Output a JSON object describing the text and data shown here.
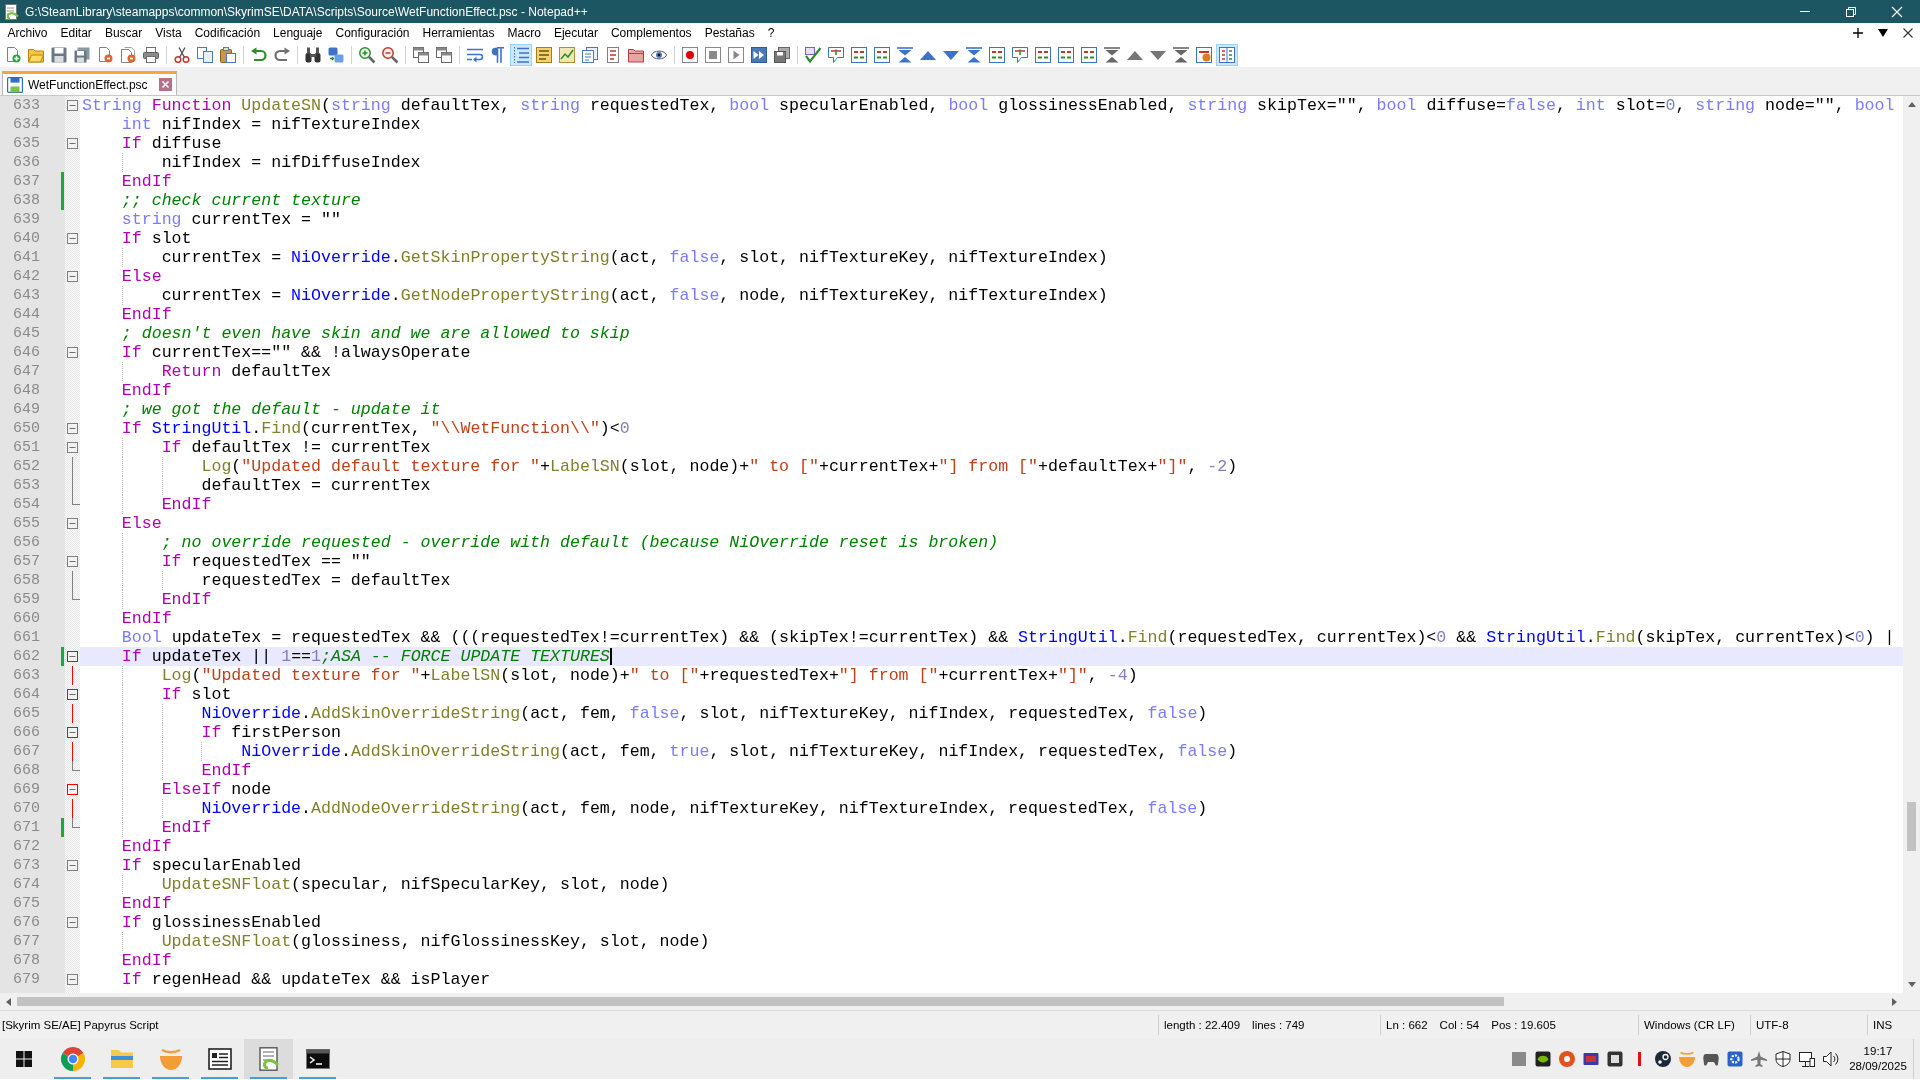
{
  "window": {
    "title": "G:\\SteamLibrary\\steamapps\\common\\SkyrimSE\\DATA\\Scripts\\Source\\WetFunctionEffect.psc - Notepad++"
  },
  "menu_bar": {
    "items": [
      "Archivo",
      "Editar",
      "Buscar",
      "Vista",
      "Codificación",
      "Lenguaje",
      "Configuración",
      "Herramientas",
      "Macro",
      "Ejecutar",
      "Complementos",
      "Pestañas",
      "?"
    ]
  },
  "toolbar": [
    {
      "buttons": [
        {
          "pressed": false
        },
        {
          "pressed": false
        },
        {
          "pressed": false
        },
        {
          "pressed": false
        },
        {
          "pressed": false
        },
        {
          "pressed": false
        },
        {
          "pressed": false
        }
      ]
    },
    {
      "buttons": [
        {
          "pressed": false
        },
        {
          "pressed": false
        },
        {
          "pressed": false
        }
      ]
    },
    {
      "buttons": [
        {
          "pressed": false
        },
        {
          "pressed": false
        }
      ]
    },
    {
      "buttons": [
        {
          "pressed": false
        },
        {
          "pressed": false
        }
      ]
    },
    {
      "buttons": [
        {
          "pressed": false
        },
        {
          "pressed": false
        }
      ]
    },
    {
      "buttons": [
        {
          "pressed": false
        },
        {
          "pressed": false
        }
      ]
    },
    {
      "buttons": [
        {
          "pressed": false
        },
        {
          "pressed": false
        },
        {
          "pressed": true
        },
        {
          "pressed": false
        },
        {
          "pressed": false
        },
        {
          "pressed": false
        },
        {
          "pressed": false
        },
        {
          "pressed": false
        },
        {
          "pressed": false
        }
      ]
    },
    {
      "buttons": [
        {
          "pressed": false
        },
        {
          "pressed": false
        },
        {
          "pressed": false
        },
        {
          "pressed": false
        },
        {
          "pressed": false
        }
      ]
    },
    {
      "buttons": [
        {
          "pressed": false
        },
        {
          "pressed": false
        },
        {
          "pressed": false
        },
        {
          "pressed": false
        },
        {
          "pressed": false
        },
        {
          "pressed": false
        },
        {
          "pressed": false
        },
        {
          "pressed": false
        },
        {
          "pressed": false
        },
        {
          "pressed": false
        },
        {
          "pressed": false
        },
        {
          "pressed": false
        },
        {
          "pressed": false
        },
        {
          "pressed": false
        },
        {
          "pressed": false
        },
        {
          "pressed": false
        },
        {
          "pressed": false
        },
        {
          "pressed": false
        },
        {
          "pressed": true
        }
      ]
    }
  ],
  "tabs": [
    {
      "label": "WetFunctionEffect.psc",
      "selected": true
    }
  ],
  "editor": {
    "lines": [
      {
        "number": "633",
        "current": false,
        "changed": false,
        "fold": {
          "kind": "start",
          "highlight": false
        },
        "tokens": [
          {
            "kind": "type",
            "text": "String"
          },
          {
            "kind": "keyword",
            "text": " Function"
          },
          {
            "kind": "function",
            "text": " UpdateSN"
          },
          {
            "kind": "plain",
            "text": "("
          },
          {
            "kind": "type",
            "text": "string"
          },
          {
            "kind": "plain",
            "text": " defaultTex, "
          },
          {
            "kind": "type",
            "text": "string"
          },
          {
            "kind": "plain",
            "text": " requestedTex, "
          },
          {
            "kind": "type",
            "text": "bool"
          },
          {
            "kind": "plain",
            "text": " specularEnabled, "
          },
          {
            "kind": "type",
            "text": "bool"
          },
          {
            "kind": "plain",
            "text": " glossinessEnabled, "
          },
          {
            "kind": "type",
            "text": "string"
          },
          {
            "kind": "plain",
            "text": " skipTex=\"\", "
          },
          {
            "kind": "type",
            "text": "bool"
          },
          {
            "kind": "plain",
            "text": " diffuse="
          },
          {
            "kind": "type",
            "text": "false"
          },
          {
            "kind": "plain",
            "text": ", "
          },
          {
            "kind": "type",
            "text": "int"
          },
          {
            "kind": "plain",
            "text": " slot="
          },
          {
            "kind": "number",
            "text": "0"
          },
          {
            "kind": "plain",
            "text": ", "
          },
          {
            "kind": "type",
            "text": "string"
          },
          {
            "kind": "plain",
            "text": " node=\"\", "
          },
          {
            "kind": "type",
            "text": "bool"
          }
        ],
        "children": [
          {
            "number": "634",
            "current": false,
            "changed": false,
            "tokens": [
              {
                "kind": "type",
                "text": "int"
              },
              {
                "kind": "plain",
                "text": " nifIndex = nifTextureIndex"
              }
            ]
          },
          {
            "number": "635",
            "current": false,
            "changed": false,
            "fold": {
              "kind": "start",
              "highlight": false
            },
            "tokens": [
              {
                "kind": "keyword",
                "text": "If"
              },
              {
                "kind": "plain",
                "text": " diffuse"
              }
            ],
            "children": [
              {
                "number": "636",
                "current": false,
                "changed": false,
                "tokens": [
                  {
                    "kind": "plain",
                    "text": "nifIndex = nifDiffuseIndex"
                  }
                ]
              }
            ]
          },
          {
            "number": "637",
            "current": false,
            "changed": true,
            "tokens": [
              {
                "kind": "keyword",
                "text": "EndIf"
              }
            ]
          },
          {
            "number": "638",
            "current": false,
            "changed": true,
            "tokens": [
              {
                "kind": "comment",
                "text": ";; check current texture"
              }
            ]
          },
          {
            "number": "639",
            "current": false,
            "changed": false,
            "tokens": [
              {
                "kind": "type",
                "text": "string"
              },
              {
                "kind": "plain",
                "text": " currentTex = \"\""
              }
            ]
          },
          {
            "number": "640",
            "current": false,
            "changed": false,
            "fold": {
              "kind": "start",
              "highlight": false
            },
            "tokens": [
              {
                "kind": "keyword",
                "text": "If"
              },
              {
                "kind": "plain",
                "text": " slot"
              }
            ],
            "children": [
              {
                "number": "641",
                "current": false,
                "changed": false,
                "tokens": [
                  {
                    "kind": "plain",
                    "text": "currentTex = "
                  },
                  {
                    "kind": "class",
                    "text": "NiOverride"
                  },
                  {
                    "kind": "plain",
                    "text": "."
                  },
                  {
                    "kind": "function",
                    "text": "GetSkinPropertyString"
                  },
                  {
                    "kind": "plain",
                    "text": "(act, "
                  },
                  {
                    "kind": "type",
                    "text": "false"
                  },
                  {
                    "kind": "plain",
                    "text": ", slot, nifTextureKey, nifTextureIndex)"
                  }
                ]
              }
            ]
          },
          {
            "number": "642",
            "current": false,
            "changed": false,
            "fold": {
              "kind": "start",
              "highlight": false
            },
            "tokens": [
              {
                "kind": "keyword",
                "text": "Else"
              }
            ],
            "children": [
              {
                "number": "643",
                "current": false,
                "changed": false,
                "tokens": [
                  {
                    "kind": "plain",
                    "text": "currentTex = "
                  },
                  {
                    "kind": "class",
                    "text": "NiOverride"
                  },
                  {
                    "kind": "plain",
                    "text": "."
                  },
                  {
                    "kind": "function",
                    "text": "GetNodePropertyString"
                  },
                  {
                    "kind": "plain",
                    "text": "(act, "
                  },
                  {
                    "kind": "type",
                    "text": "false"
                  },
                  {
                    "kind": "plain",
                    "text": ", node, nifTextureKey, nifTextureIndex)"
                  }
                ]
              }
            ]
          },
          {
            "number": "644",
            "current": false,
            "changed": false,
            "tokens": [
              {
                "kind": "keyword",
                "text": "EndIf"
              }
            ]
          },
          {
            "number": "645",
            "current": false,
            "changed": false,
            "tokens": [
              {
                "kind": "comment",
                "text": "; doesn't even have skin and we are allowed to skip"
              }
            ]
          },
          {
            "number": "646",
            "current": false,
            "changed": false,
            "fold": {
              "kind": "start",
              "highlight": false
            },
            "tokens": [
              {
                "kind": "keyword",
                "text": "If"
              },
              {
                "kind": "plain",
                "text": " currentTex==\"\" && !alwaysOperate"
              }
            ],
            "children": [
              {
                "number": "647",
                "current": false,
                "changed": false,
                "tokens": [
                  {
                    "kind": "keyword",
                    "text": "Return"
                  },
                  {
                    "kind": "plain",
                    "text": " defaultTex"
                  }
                ]
              }
            ]
          },
          {
            "number": "648",
            "current": false,
            "changed": false,
            "tokens": [
              {
                "kind": "keyword",
                "text": "EndIf"
              }
            ]
          },
          {
            "number": "649",
            "current": false,
            "changed": false,
            "tokens": [
              {
                "kind": "comment",
                "text": "; we got the default - update it"
              }
            ]
          },
          {
            "number": "650",
            "current": false,
            "changed": false,
            "fold": {
              "kind": "start",
              "highlight": false
            },
            "tokens": [
              {
                "kind": "keyword",
                "text": "If"
              },
              {
                "kind": "class",
                "text": " StringUtil"
              },
              {
                "kind": "plain",
                "text": "."
              },
              {
                "kind": "function",
                "text": "Find"
              },
              {
                "kind": "plain",
                "text": "(currentTex, "
              },
              {
                "kind": "string",
                "text": "\"\\\\WetFunction\\\\\""
              },
              {
                "kind": "plain",
                "text": ")<"
              },
              {
                "kind": "number",
                "text": "0"
              }
            ],
            "children": [
              {
                "number": "651",
                "current": false,
                "changed": false,
                "fold": {
                  "kind": "start",
                  "highlight": false
                },
                "tokens": [
                  {
                    "kind": "keyword",
                    "text": "If"
                  },
                  {
                    "kind": "plain",
                    "text": " defaultTex != currentTex"
                  }
                ],
                "children": [
                  {
                    "number": "652",
                    "current": false,
                    "changed": false,
                    "fold": {
                      "kind": "line",
                      "highlight": false
                    },
                    "tokens": [
                      {
                        "kind": "function",
                        "text": "Log"
                      },
                      {
                        "kind": "plain",
                        "text": "("
                      },
                      {
                        "kind": "string",
                        "text": "\"Updated default texture for \""
                      },
                      {
                        "kind": "plain",
                        "text": "+"
                      },
                      {
                        "kind": "function",
                        "text": "LabelSN"
                      },
                      {
                        "kind": "plain",
                        "text": "(slot, node)+"
                      },
                      {
                        "kind": "string",
                        "text": "\" to [\""
                      },
                      {
                        "kind": "plain",
                        "text": "+currentTex+"
                      },
                      {
                        "kind": "string",
                        "text": "\"] from [\""
                      },
                      {
                        "kind": "plain",
                        "text": "+defaultTex+"
                      },
                      {
                        "kind": "string",
                        "text": "\"]\""
                      },
                      {
                        "kind": "plain",
                        "text": ", "
                      },
                      {
                        "kind": "number",
                        "text": "-2"
                      },
                      {
                        "kind": "plain",
                        "text": ")"
                      }
                    ]
                  },
                  {
                    "number": "653",
                    "current": false,
                    "changed": false,
                    "fold": {
                      "kind": "line",
                      "highlight": false
                    },
                    "tokens": [
                      {
                        "kind": "plain",
                        "text": "defaultTex = currentTex"
                      }
                    ]
                  }
                ]
              },
              {
                "number": "654",
                "current": false,
                "changed": false,
                "fold": {
                  "kind": "end",
                  "highlight": false
                },
                "tokens": [
                  {
                    "kind": "keyword",
                    "text": "EndIf"
                  }
                ]
              }
            ]
          },
          {
            "number": "655",
            "current": false,
            "changed": false,
            "fold": {
              "kind": "start",
              "highlight": false
            },
            "tokens": [
              {
                "kind": "keyword",
                "text": "Else"
              }
            ],
            "children": [
              {
                "number": "656",
                "current": false,
                "changed": false,
                "tokens": [
                  {
                    "kind": "comment",
                    "text": "; no override requested - override with default (because NiOverride reset is broken)"
                  }
                ]
              },
              {
                "number": "657",
                "current": false,
                "changed": false,
                "fold": {
                  "kind": "start",
                  "highlight": false
                },
                "tokens": [
                  {
                    "kind": "keyword",
                    "text": "If"
                  },
                  {
                    "kind": "plain",
                    "text": " requestedTex == \"\""
                  }
                ],
                "children": [
                  {
                    "number": "658",
                    "current": false,
                    "changed": false,
                    "fold": {
                      "kind": "line",
                      "highlight": false
                    },
                    "tokens": [
                      {
                        "kind": "plain",
                        "text": "requestedTex = defaultTex"
                      }
                    ]
                  }
                ]
              },
              {
                "number": "659",
                "current": false,
                "changed": false,
                "fold": {
                  "kind": "end",
                  "highlight": false
                },
                "tokens": [
                  {
                    "kind": "keyword",
                    "text": "EndIf"
                  }
                ]
              }
            ]
          },
          {
            "number": "660",
            "current": false,
            "changed": false,
            "tokens": [
              {
                "kind": "keyword",
                "text": "EndIf"
              }
            ]
          },
          {
            "number": "661",
            "current": false,
            "changed": false,
            "tokens": [
              {
                "kind": "type",
                "text": "Bool"
              },
              {
                "kind": "plain",
                "text": " updateTex = requestedTex && (((requestedTex!=currentTex) && (skipTex!=currentTex) && "
              },
              {
                "kind": "class",
                "text": "StringUtil"
              },
              {
                "kind": "plain",
                "text": "."
              },
              {
                "kind": "function",
                "text": "Find"
              },
              {
                "kind": "plain",
                "text": "(requestedTex, currentTex)<"
              },
              {
                "kind": "number",
                "text": "0"
              },
              {
                "kind": "plain",
                "text": " && "
              },
              {
                "kind": "class",
                "text": "StringUtil"
              },
              {
                "kind": "plain",
                "text": "."
              },
              {
                "kind": "function",
                "text": "Find"
              },
              {
                "kind": "plain",
                "text": "(skipTex, currentTex)<"
              },
              {
                "kind": "number",
                "text": "0"
              },
              {
                "kind": "plain",
                "text": ") |"
              }
            ]
          },
          {
            "number": "662",
            "current": true,
            "changed": true,
            "fold": {
              "kind": "start",
              "highlight": true
            },
            "tokens": [
              {
                "kind": "keyword",
                "text": "If"
              },
              {
                "kind": "plain",
                "text": " updateTex || "
              },
              {
                "kind": "number",
                "text": "1"
              },
              {
                "kind": "plain",
                "text": "=="
              },
              {
                "kind": "number",
                "text": "1"
              },
              {
                "kind": "comment",
                "text": ";ASA -- FORCE UPDATE TEXTURES"
              }
            ],
            "children": [
              {
                "number": "663",
                "current": false,
                "changed": false,
                "fold": {
                  "kind": "line",
                  "highlight": true
                },
                "tokens": [
                  {
                    "kind": "function",
                    "text": "Log"
                  },
                  {
                    "kind": "plain",
                    "text": "("
                  },
                  {
                    "kind": "string",
                    "text": "\"Updated texture for \""
                  },
                  {
                    "kind": "plain",
                    "text": "+"
                  },
                  {
                    "kind": "function",
                    "text": "LabelSN"
                  },
                  {
                    "kind": "plain",
                    "text": "(slot, node)+"
                  },
                  {
                    "kind": "string",
                    "text": "\" to [\""
                  },
                  {
                    "kind": "plain",
                    "text": "+requestedTex+"
                  },
                  {
                    "kind": "string",
                    "text": "\"] from [\""
                  },
                  {
                    "kind": "plain",
                    "text": "+currentTex+"
                  },
                  {
                    "kind": "string",
                    "text": "\"]\""
                  },
                  {
                    "kind": "plain",
                    "text": ", "
                  },
                  {
                    "kind": "number",
                    "text": "-4"
                  },
                  {
                    "kind": "plain",
                    "text": ")"
                  }
                ]
              },
              {
                "number": "664",
                "current": false,
                "changed": false,
                "fold": {
                  "kind": "start",
                  "highlight": true
                },
                "tokens": [
                  {
                    "kind": "keyword",
                    "text": "If"
                  },
                  {
                    "kind": "plain",
                    "text": " slot"
                  }
                ],
                "children": [
                  {
                    "number": "665",
                    "current": false,
                    "changed": false,
                    "fold": {
                      "kind": "line",
                      "highlight": true
                    },
                    "tokens": [
                      {
                        "kind": "class",
                        "text": "NiOverride"
                      },
                      {
                        "kind": "plain",
                        "text": "."
                      },
                      {
                        "kind": "function",
                        "text": "AddSkinOverrideString"
                      },
                      {
                        "kind": "plain",
                        "text": "(act, fem, "
                      },
                      {
                        "kind": "type",
                        "text": "false"
                      },
                      {
                        "kind": "plain",
                        "text": ", slot, nifTextureKey, nifIndex, requestedTex, "
                      },
                      {
                        "kind": "type",
                        "text": "false"
                      },
                      {
                        "kind": "plain",
                        "text": ")"
                      }
                    ]
                  },
                  {
                    "number": "666",
                    "current": false,
                    "changed": false,
                    "fold": {
                      "kind": "start",
                      "highlight": true
                    },
                    "tokens": [
                      {
                        "kind": "keyword",
                        "text": "If"
                      },
                      {
                        "kind": "plain",
                        "text": " firstPerson"
                      }
                    ],
                    "children": [
                      {
                        "number": "667",
                        "current": false,
                        "changed": false,
                        "fold": {
                          "kind": "line",
                          "highlight": true
                        },
                        "tokens": [
                          {
                            "kind": "class",
                            "text": "NiOverride"
                          },
                          {
                            "kind": "plain",
                            "text": "."
                          },
                          {
                            "kind": "function",
                            "text": "AddSkinOverrideString"
                          },
                          {
                            "kind": "plain",
                            "text": "(act, fem, "
                          },
                          {
                            "kind": "type",
                            "text": "true"
                          },
                          {
                            "kind": "plain",
                            "text": ", slot, nifTextureKey, nifIndex, requestedTex, "
                          },
                          {
                            "kind": "type",
                            "text": "false"
                          },
                          {
                            "kind": "plain",
                            "text": ")"
                          }
                        ]
                      }
                    ]
                  },
                  {
                    "number": "668",
                    "current": false,
                    "changed": false,
                    "fold": {
                      "kind": "end",
                      "highlight": false
                    },
                    "tokens": [
                      {
                        "kind": "keyword",
                        "text": "EndIf"
                      }
                    ]
                  }
                ]
              },
              {
                "number": "669",
                "current": false,
                "changed": false,
                "fold": {
                  "kind": "start",
                  "highlight": true
                },
                "tokens": [
                  {
                    "kind": "keyword",
                    "text": "ElseIf"
                  },
                  {
                    "kind": "plain",
                    "text": " node"
                  }
                ],
                "children": [
                  {
                    "number": "670",
                    "current": false,
                    "changed": false,
                    "fold": {
                      "kind": "line",
                      "highlight": true
                    },
                    "tokens": [
                      {
                        "kind": "class",
                        "text": "NiOverride"
                      },
                      {
                        "kind": "plain",
                        "text": "."
                      },
                      {
                        "kind": "function",
                        "text": "AddNodeOverrideString"
                      },
                      {
                        "kind": "plain",
                        "text": "(act, fem, node, nifTextureKey, nifTextureIndex, requestedTex, "
                      },
                      {
                        "kind": "type",
                        "text": "false"
                      },
                      {
                        "kind": "plain",
                        "text": ")"
                      }
                    ]
                  }
                ]
              },
              {
                "number": "671",
                "current": false,
                "changed": true,
                "fold": {
                  "kind": "end",
                  "highlight": false
                },
                "tokens": [
                  {
                    "kind": "keyword",
                    "text": "EndIf"
                  }
                ]
              }
            ]
          },
          {
            "number": "672",
            "current": false,
            "changed": false,
            "tokens": [
              {
                "kind": "keyword",
                "text": "EndIf"
              }
            ]
          },
          {
            "number": "673",
            "current": false,
            "changed": false,
            "fold": {
              "kind": "start",
              "highlight": false
            },
            "tokens": [
              {
                "kind": "keyword",
                "text": "If"
              },
              {
                "kind": "plain",
                "text": " specularEnabled"
              }
            ],
            "children": [
              {
                "number": "674",
                "current": false,
                "changed": false,
                "tokens": [
                  {
                    "kind": "function",
                    "text": "UpdateSNFloat"
                  },
                  {
                    "kind": "plain",
                    "text": "(specular, nifSpecularKey, slot, node)"
                  }
                ]
              }
            ]
          },
          {
            "number": "675",
            "current": false,
            "changed": false,
            "tokens": [
              {
                "kind": "keyword",
                "text": "EndIf"
              }
            ]
          },
          {
            "number": "676",
            "current": false,
            "changed": false,
            "fold": {
              "kind": "start",
              "highlight": false
            },
            "tokens": [
              {
                "kind": "keyword",
                "text": "If"
              },
              {
                "kind": "plain",
                "text": " glossinessEnabled"
              }
            ],
            "children": [
              {
                "number": "677",
                "current": false,
                "changed": false,
                "tokens": [
                  {
                    "kind": "function",
                    "text": "UpdateSNFloat"
                  },
                  {
                    "kind": "plain",
                    "text": "(glossiness, nifGlossinessKey, slot, node)"
                  }
                ]
              }
            ]
          },
          {
            "number": "678",
            "current": false,
            "changed": false,
            "tokens": [
              {
                "kind": "keyword",
                "text": "EndIf"
              }
            ]
          },
          {
            "number": "679",
            "current": false,
            "changed": false,
            "fold": {
              "kind": "start",
              "highlight": false
            },
            "tokens": [
              {
                "kind": "keyword",
                "text": "If"
              },
              {
                "kind": "plain",
                "text": " regenHead && updateTex && isPlayer"
              }
            ]
          }
        ]
      }
    ]
  },
  "status_bar": {
    "language": "[Skyrim SE/AE] Papyrus Script",
    "length": "length : 22.409",
    "lines": "lines : 749",
    "line": "Ln : 662",
    "column": "Col : 54",
    "position": "Pos : 19.605",
    "eol": "Windows (CR LF)",
    "encoding": "UTF-8",
    "mode": "INS"
  },
  "taskbar": {
    "apps": [
      {
        "running": true,
        "selected": false
      },
      {
        "running": true,
        "selected": false
      },
      {
        "running": true,
        "selected": false
      },
      {
        "running": true,
        "selected": false
      },
      {
        "running": true,
        "selected": true
      },
      {
        "running": true,
        "selected": false
      }
    ],
    "clock": {
      "time": "19:17",
      "date": "28/09/2025"
    }
  }
}
